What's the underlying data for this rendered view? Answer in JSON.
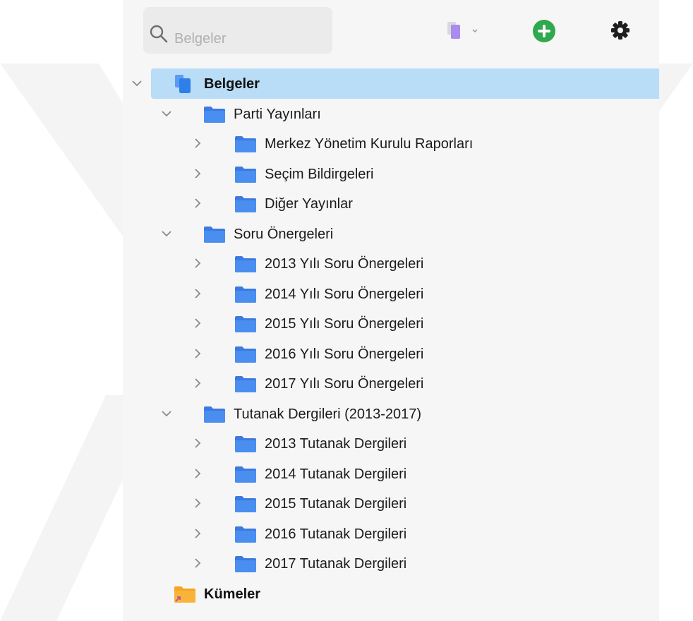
{
  "toolbar": {
    "search": {
      "placeholder": "Belgeler",
      "icon": "search-icon"
    },
    "document_menu": {
      "icon": "documents-icon",
      "dropdown_icon": "chevron-down-icon"
    },
    "add_button": {
      "icon": "plus-circle-icon",
      "color": "#2fa84f"
    },
    "settings_button": {
      "icon": "gear-icon"
    }
  },
  "colors": {
    "folder": "#4a8ef0",
    "folder_dark": "#3b7ae0",
    "selection": "#b9dcf7",
    "documents_icon": "#3b86f0",
    "clusters_icon": "#f8b43a"
  },
  "sidebar": {
    "root": {
      "label": "Belgeler",
      "expanded": true,
      "selected": true,
      "icon": "documents-icon"
    },
    "groups": [
      {
        "label": "Parti Yayınları",
        "expanded": true,
        "children": [
          {
            "label": "Merkez Yönetim Kurulu Raporları"
          },
          {
            "label": "Seçim Bildirgeleri"
          },
          {
            "label": "Diğer Yayınlar"
          }
        ]
      },
      {
        "label": "Soru Önergeleri",
        "expanded": true,
        "children": [
          {
            "label": "2013 Yılı Soru Önergeleri"
          },
          {
            "label": "2014 Yılı Soru Önergeleri"
          },
          {
            "label": "2015 Yılı Soru Önergeleri"
          },
          {
            "label": "2016 Yılı Soru Önergeleri"
          },
          {
            "label": "2017 Yılı Soru Önergeleri"
          }
        ]
      },
      {
        "label": "Tutanak Dergileri (2013-2017)",
        "expanded": true,
        "children": [
          {
            "label": "2013 Tutanak Dergileri"
          },
          {
            "label": "2014 Tutanak Dergileri"
          },
          {
            "label": "2015 Tutanak Dergileri"
          },
          {
            "label": "2016 Tutanak Dergileri"
          },
          {
            "label": "2017 Tutanak Dergileri"
          }
        ]
      }
    ],
    "clusters": {
      "label": "Kümeler",
      "icon": "clusters-folder-icon"
    }
  }
}
